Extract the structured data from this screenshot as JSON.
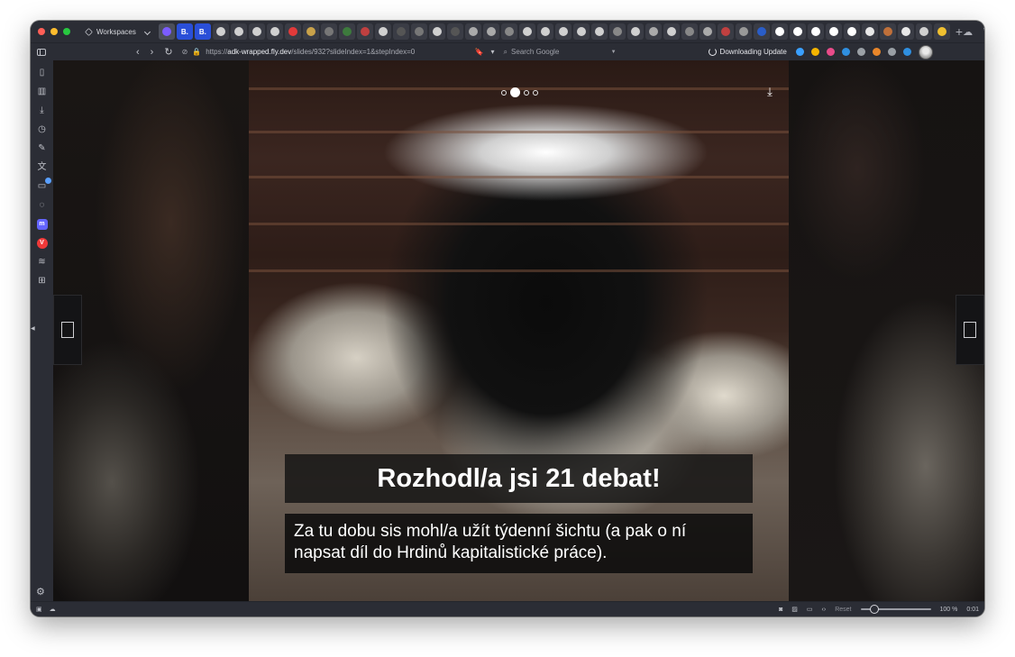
{
  "browser": {
    "workspaces_label": "Workspaces",
    "tabs": [
      {
        "glyph": "",
        "color": "#7b5cff"
      },
      {
        "glyph": "B.",
        "color": "#2a4fd8"
      },
      {
        "glyph": "B.",
        "color": "#2a4fd8"
      },
      {
        "glyph": "",
        "color": "#d0d0d0"
      },
      {
        "glyph": "",
        "color": "#d0d0d0"
      },
      {
        "glyph": "",
        "color": "#d0d0d0"
      },
      {
        "glyph": "",
        "color": "#d0d0d0"
      },
      {
        "glyph": "",
        "color": "#e23a3a"
      },
      {
        "glyph": "",
        "color": "#c9a24a"
      },
      {
        "glyph": "",
        "color": "#777777"
      },
      {
        "glyph": "",
        "color": "#3d7a3d"
      },
      {
        "glyph": "",
        "color": "#c04040"
      },
      {
        "glyph": "",
        "color": "#d0d0d0"
      },
      {
        "glyph": "",
        "color": "#555555"
      },
      {
        "glyph": "",
        "color": "#777777"
      },
      {
        "glyph": "",
        "color": "#d0d0d0"
      },
      {
        "glyph": "",
        "color": "#555555"
      },
      {
        "glyph": "",
        "color": "#aaaaaa"
      },
      {
        "glyph": "",
        "color": "#aaaaaa"
      },
      {
        "glyph": "",
        "color": "#888888"
      },
      {
        "glyph": "",
        "color": "#d0d0d0"
      },
      {
        "glyph": "",
        "color": "#d0d0d0"
      },
      {
        "glyph": "",
        "color": "#d0d0d0"
      },
      {
        "glyph": "",
        "color": "#d0d0d0"
      },
      {
        "glyph": "",
        "color": "#d0d0d0"
      },
      {
        "glyph": "",
        "color": "#888888"
      },
      {
        "glyph": "",
        "color": "#d0d0d0"
      },
      {
        "glyph": "",
        "color": "#aaaaaa"
      },
      {
        "glyph": "",
        "color": "#d0d0d0"
      },
      {
        "glyph": "",
        "color": "#888888"
      },
      {
        "glyph": "",
        "color": "#aaaaaa"
      },
      {
        "glyph": "",
        "color": "#c04040"
      },
      {
        "glyph": "",
        "color": "#999999"
      },
      {
        "glyph": "",
        "color": "#2a5dc8"
      },
      {
        "glyph": "",
        "color": "#ffffff"
      },
      {
        "glyph": "",
        "color": "#ffffff"
      },
      {
        "glyph": "",
        "color": "#ffffff"
      },
      {
        "glyph": "",
        "color": "#ffffff"
      },
      {
        "glyph": "",
        "color": "#ffffff"
      },
      {
        "glyph": "",
        "color": "#e8e8e8"
      },
      {
        "glyph": "",
        "color": "#c0703a"
      },
      {
        "glyph": "",
        "color": "#e8e8e8"
      },
      {
        "glyph": "",
        "color": "#d0d0d0"
      },
      {
        "glyph": "",
        "color": "#f0c030"
      }
    ],
    "url_prefix": "https://",
    "url_host": "adk-wrapped.fly.dev",
    "url_path": "/slides/932?slideIndex=1&stepIndex=0",
    "search_placeholder": "Search Google",
    "download_label": "Downloading Update",
    "extension_colors": [
      "#3aa0ff",
      "#f4b400",
      "#e94b8a",
      "#2f8fe0",
      "#9aa0a6",
      "#e8862a",
      "#9aa0a6",
      "#2f8fe0"
    ],
    "zoom_reset": "Reset",
    "zoom_level": "100 %",
    "clock": "0:01"
  },
  "slide": {
    "step_total": 4,
    "step_active": 1,
    "headline": "Rozhodl/a jsi 21 debat!",
    "body_line1": "Za tu dobu sis mohl/a užít týdenní šichtu (a pak o ní",
    "body_line2": "napsat díl do Hrdinů kapitalistické práce)."
  }
}
